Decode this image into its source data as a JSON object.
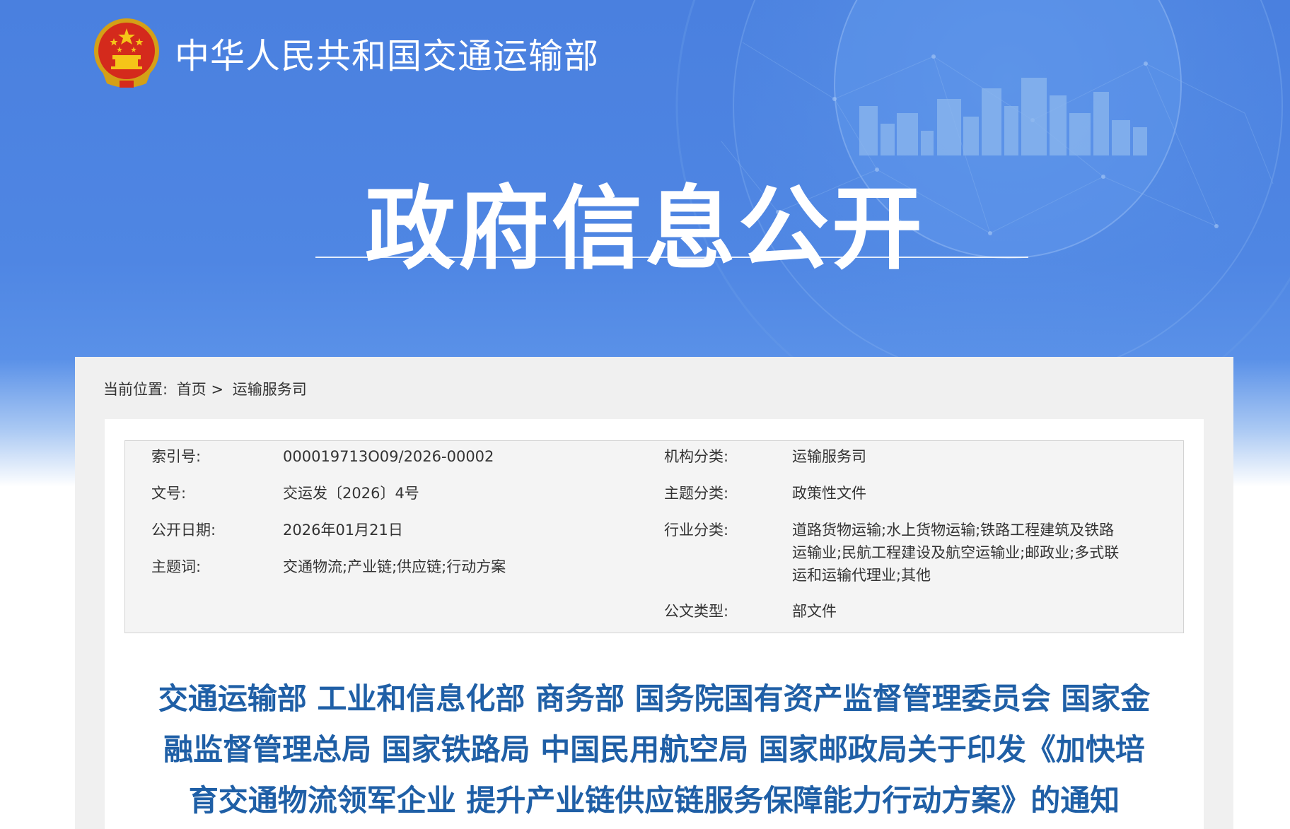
{
  "header": {
    "ministry_name": "中华人民共和国交通运输部",
    "banner_title": "政府信息公开"
  },
  "breadcrumb": {
    "prefix": "当前位置:",
    "home": "首页",
    "separator": ">",
    "current": "运输服务司"
  },
  "metadata": {
    "index_no_label": "索引号:",
    "index_no": "000019713O09/2026-00002",
    "doc_no_label": "文号:",
    "doc_no": "交运发〔2026〕4号",
    "publish_date_label": "公开日期:",
    "publish_date": "2026年01月21日",
    "keywords_label": "主题词:",
    "keywords": "交通物流;产业链;供应链;行动方案",
    "org_label": "机构分类:",
    "org": "运输服务司",
    "topic_label": "主题分类:",
    "topic": "政策性文件",
    "industry_label": "行业分类:",
    "industry_lines": [
      "道路货物运输;水上货物运输;铁路工程建筑及铁路",
      "运输业;民航工程建设及航空运输业;邮政业;多式联",
      "运和运输代理业;其他"
    ],
    "doc_type_label": "公文类型:",
    "doc_type": "部文件"
  },
  "document": {
    "title_lines": [
      "交通运输部 工业和信息化部 商务部 国务院国有资产监督管理委员会 国家金",
      "融监督管理总局 国家铁路局 中国民用航空局 国家邮政局关于印发《加快培",
      "育交通物流领军企业 提升产业链供应链服务保障能力行动方案》的通知"
    ]
  },
  "colors": {
    "banner_blue": "#4a80df",
    "title_blue": "#1f5fa6",
    "card_gray": "#f0f0f0",
    "meta_gray": "#f4f4f4"
  }
}
